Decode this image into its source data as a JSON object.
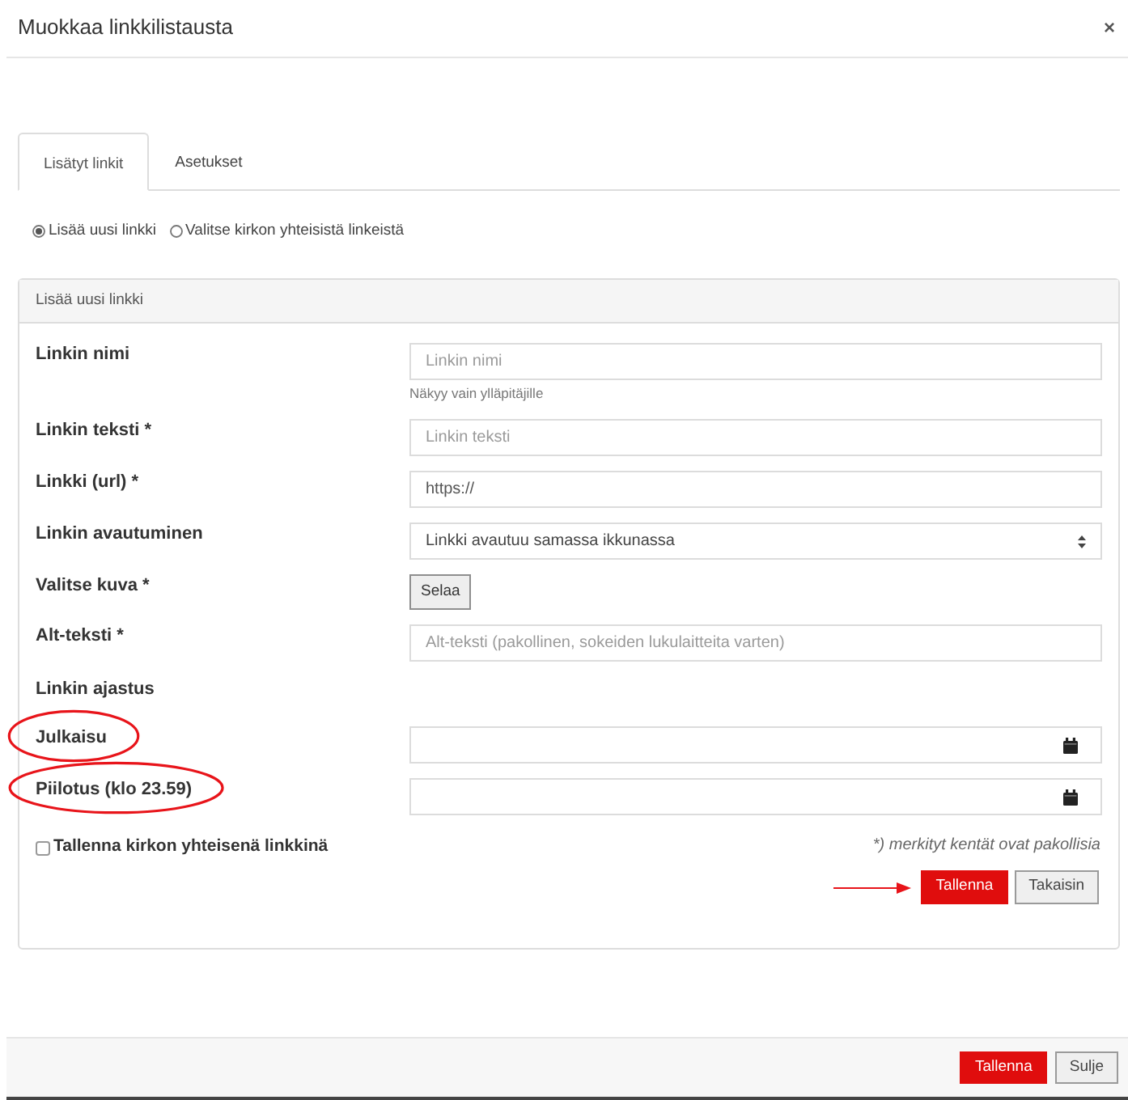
{
  "dialog": {
    "title": "Muokkaa linkkilistausta",
    "close": "×"
  },
  "tabs": [
    {
      "label": "Lisätyt linkit",
      "selected": true
    },
    {
      "label": "Asetukset",
      "selected": false
    }
  ],
  "source_options": [
    {
      "label": "Lisää uusi linkki",
      "selected": true
    },
    {
      "label": "Valitse kirkon yhteisistä linkeistä",
      "selected": false
    }
  ],
  "panel": {
    "heading": "Lisää uusi linkki",
    "fields": [
      {
        "kind": "text",
        "label": "Linkin nimi",
        "placeholder": "Linkin nimi",
        "help": "Näkyy vain ylläpitäjille",
        "circled": false
      },
      {
        "kind": "text",
        "label": "Linkin teksti *",
        "placeholder": "Linkin teksti",
        "circled": false
      },
      {
        "kind": "text",
        "label": "Linkki (url) *",
        "value": "https://",
        "circled": false
      },
      {
        "kind": "select",
        "label": "Linkin avautuminen",
        "value": "Linkki avautuu samassa ikkunassa",
        "circled": false
      },
      {
        "kind": "file",
        "label": "Valitse kuva *",
        "button": "Selaa",
        "circled": false
      },
      {
        "kind": "text",
        "label": "Alt-teksti *",
        "placeholder": "Alt-teksti (pakollinen, sokeiden lukulaitteita varten)",
        "circled": false
      },
      {
        "kind": "heading",
        "label": "Linkin ajastus",
        "circled": false
      },
      {
        "kind": "date",
        "label": "Julkaisu",
        "circled": true
      },
      {
        "kind": "date",
        "label": "Piilotus (klo 23.59)",
        "circled": true
      }
    ],
    "shared_checkbox": {
      "label": "Tallenna kirkon yhteisenä linkkinä",
      "checked": false
    },
    "required_note": "*) merkityt kentät ovat pakollisia",
    "buttons": [
      {
        "label": "Tallenna",
        "kind": "primary",
        "arrow": true
      },
      {
        "label": "Takaisin",
        "kind": "secondary",
        "arrow": false
      }
    ]
  },
  "footer": {
    "buttons": [
      {
        "label": "Tallenna",
        "kind": "primary"
      },
      {
        "label": "Sulje",
        "kind": "secondary"
      }
    ]
  }
}
